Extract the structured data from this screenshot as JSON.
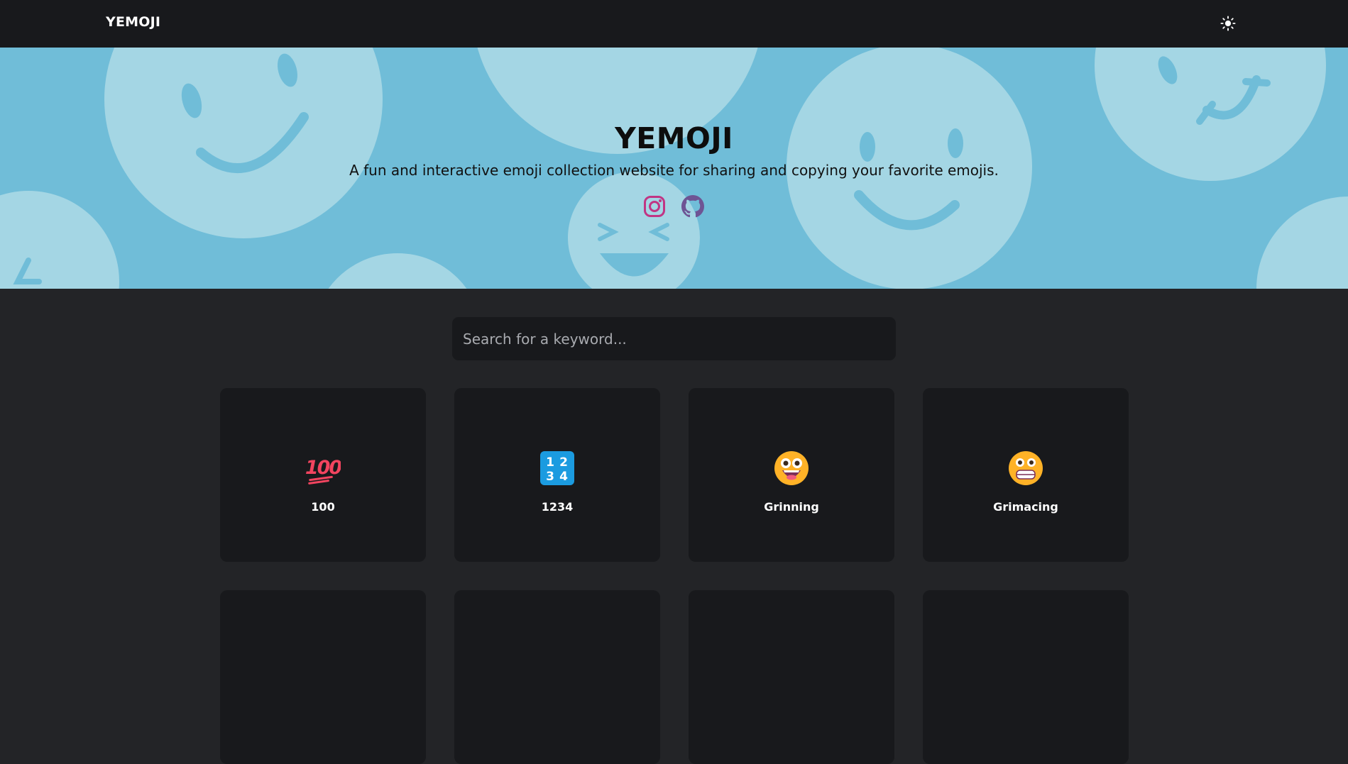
{
  "navbar": {
    "brand": "YEMOJI",
    "theme_icon": "sun-icon"
  },
  "hero": {
    "title": "YEMOJI",
    "subtitle": "A fun and interactive emoji collection website for sharing and copying your favorite emojis.",
    "socials": [
      {
        "icon": "instagram-icon",
        "color": "#c13584"
      },
      {
        "icon": "github-icon",
        "color": "#6e5494"
      }
    ],
    "background_color": "#70bdd8"
  },
  "search": {
    "placeholder": "Search for a keyword..."
  },
  "emojis": [
    {
      "name": "100",
      "icon": "hundred-points-icon"
    },
    {
      "name": "1234",
      "icon": "input-numbers-icon"
    },
    {
      "name": "Grinning",
      "icon": "grinning-face-icon"
    },
    {
      "name": "Grimacing",
      "icon": "grimacing-face-icon"
    }
  ],
  "colors": {
    "page_bg": "#232427",
    "card_bg": "#18191c",
    "navbar_bg": "#18191c"
  }
}
